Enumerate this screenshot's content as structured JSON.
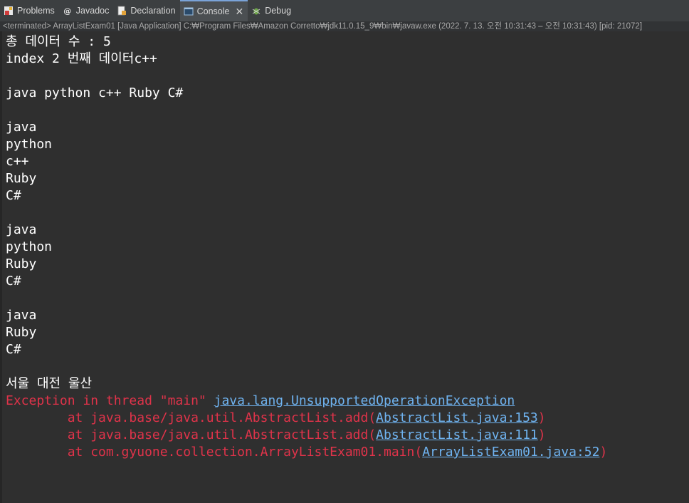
{
  "tabs": [
    {
      "label": "Problems",
      "icon": "problems-icon"
    },
    {
      "label": "Javadoc",
      "icon": "javadoc-icon"
    },
    {
      "label": "Declaration",
      "icon": "declaration-icon"
    },
    {
      "label": "Console",
      "icon": "console-icon",
      "active": true
    },
    {
      "label": "Debug",
      "icon": "debug-icon"
    }
  ],
  "status_line": "<terminated> ArrayListExam01 [Java Application] C:₩Program Files₩Amazon Corretto₩jdk11.0.15_9₩bin₩javaw.exe  (2022. 7. 13. 오전 10:31:43 – 오전 10:31:43) [pid: 21072]",
  "output": [
    "총 데이터 수 : 5",
    "index 2 번째 데이터c++",
    "",
    "java python c++ Ruby C#",
    "",
    "java",
    "python",
    "c++",
    "Ruby",
    "C#",
    "",
    "java",
    "python",
    "Ruby",
    "C#",
    "",
    "java",
    "Ruby",
    "C#",
    "",
    "서울 대전 울산"
  ],
  "exception": {
    "prefix": "Exception in thread \"main\" ",
    "class": "java.lang.UnsupportedOperationException",
    "stack": [
      {
        "text": "        at java.base/java.util.AbstractList.add(",
        "link": "AbstractList.java:153",
        "suffix": ")"
      },
      {
        "text": "        at java.base/java.util.AbstractList.add(",
        "link": "AbstractList.java:111",
        "suffix": ")"
      },
      {
        "text": "        at com.gyuone.collection.ArrayListExam01.main(",
        "link": "ArrayListExam01.java:52",
        "suffix": ")"
      }
    ]
  },
  "colors": {
    "error": "#e0334a",
    "link": "#6fb3f0",
    "background": "#2f2f2f"
  }
}
